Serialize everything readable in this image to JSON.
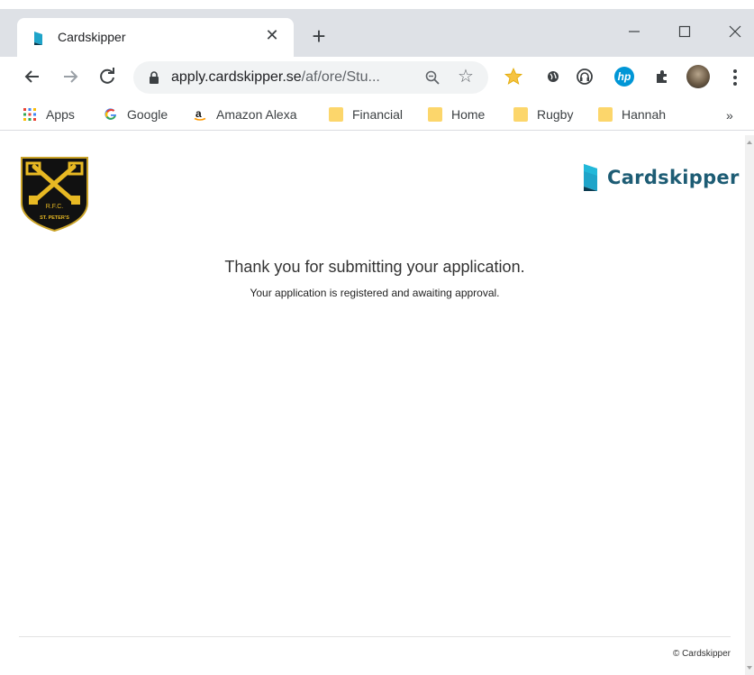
{
  "browser": {
    "tab": {
      "title": "Cardskipper"
    },
    "address": {
      "host": "apply.cardskipper.se",
      "path": "/af/ore/Stu..."
    },
    "bookmarks": [
      {
        "label": "Apps",
        "icon": "apps-grid-icon"
      },
      {
        "label": "Google",
        "icon": "google-icon"
      },
      {
        "label": "Amazon Alexa",
        "icon": "amazon-icon"
      },
      {
        "label": "Financial",
        "icon": "folder-icon"
      },
      {
        "label": "Home",
        "icon": "folder-icon"
      },
      {
        "label": "Rugby",
        "icon": "folder-icon"
      },
      {
        "label": "Hannah",
        "icon": "folder-icon"
      }
    ],
    "more_label": "»"
  },
  "page": {
    "brand_name": "Cardskipper",
    "club_logo_text": "R.F.C. ST. PETER'S",
    "heading": "Thank you for submitting your application.",
    "subheading": "Your application is registered and awaiting approval.",
    "copyright": "© Cardskipper"
  },
  "colors": {
    "brand": "#1d5c74",
    "tabstrip": "#dee1e6",
    "omnibox": "#f1f3f4",
    "folder": "#fcd66b"
  }
}
